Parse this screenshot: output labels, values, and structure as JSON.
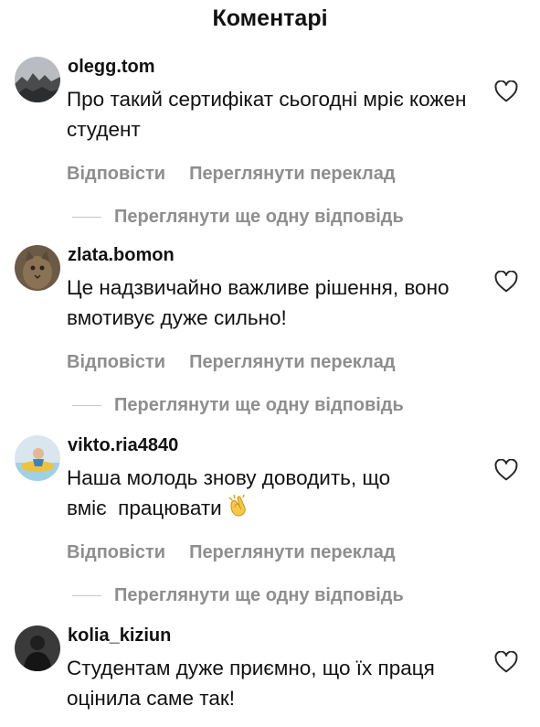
{
  "header": {
    "title": "Коментарі"
  },
  "actions": {
    "reply": "Відповісти",
    "translate": "Переглянути переклад",
    "view_more_replies": "Переглянути ще одну відповідь"
  },
  "comments": [
    {
      "username": "olegg.tom",
      "text": "Про такий сертифікат сьогодні мріє кожен студент",
      "avatar_icon": "rocky-landscape-avatar"
    },
    {
      "username": "zlata.bomon",
      "text": "Це надзвичайно важливе рішення, воно вмотивує дуже сильно!",
      "avatar_icon": "cat-avatar"
    },
    {
      "username": "vikto.ria4840",
      "text": "Наша молодь знову доводить, що вміє  працювати",
      "emoji": "clapping-hands-emoji",
      "avatar_icon": "beach-avatar"
    },
    {
      "username": "kolia_kiziun",
      "text": "Студентам дуже приємно, що їх праця оцінила саме так!",
      "avatar_icon": "person-dark-avatar"
    }
  ],
  "colors": {
    "text": "#111111",
    "secondary": "#8e8e8e"
  }
}
